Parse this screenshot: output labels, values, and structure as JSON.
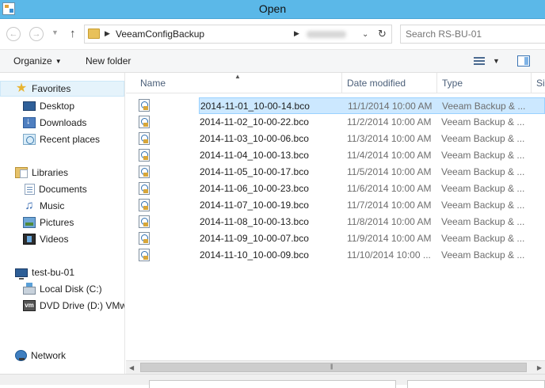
{
  "window": {
    "title": "Open"
  },
  "address": {
    "crumbs": [
      "VeeamConfigBackup"
    ],
    "search_placeholder": "Search RS-BU-01"
  },
  "toolbar": {
    "organize_label": "Organize",
    "new_folder_label": "New folder"
  },
  "nav": {
    "favorites": "Favorites",
    "desktop": "Desktop",
    "downloads": "Downloads",
    "recent": "Recent places",
    "libraries": "Libraries",
    "documents": "Documents",
    "music": "Music",
    "pictures": "Pictures",
    "videos": "Videos",
    "computer": "test-bu-01",
    "local_disk": "Local Disk (C:)",
    "dvd": "DVD Drive (D:) VMw",
    "network": "Network"
  },
  "columns": {
    "name": "Name",
    "date": "Date modified",
    "type": "Type",
    "size": "Siz"
  },
  "files": [
    {
      "name": "2014-11-01_10-00-14.bco",
      "date": "11/1/2014 10:00 AM",
      "type": "Veeam Backup & ..."
    },
    {
      "name": "2014-11-02_10-00-22.bco",
      "date": "11/2/2014 10:00 AM",
      "type": "Veeam Backup & ..."
    },
    {
      "name": "2014-11-03_10-00-06.bco",
      "date": "11/3/2014 10:00 AM",
      "type": "Veeam Backup & ..."
    },
    {
      "name": "2014-11-04_10-00-13.bco",
      "date": "11/4/2014 10:00 AM",
      "type": "Veeam Backup & ..."
    },
    {
      "name": "2014-11-05_10-00-17.bco",
      "date": "11/5/2014 10:00 AM",
      "type": "Veeam Backup & ..."
    },
    {
      "name": "2014-11-06_10-00-23.bco",
      "date": "11/6/2014 10:00 AM",
      "type": "Veeam Backup & ..."
    },
    {
      "name": "2014-11-07_10-00-19.bco",
      "date": "11/7/2014 10:00 AM",
      "type": "Veeam Backup & ..."
    },
    {
      "name": "2014-11-08_10-00-13.bco",
      "date": "11/8/2014 10:00 AM",
      "type": "Veeam Backup & ..."
    },
    {
      "name": "2014-11-09_10-00-07.bco",
      "date": "11/9/2014 10:00 AM",
      "type": "Veeam Backup & ..."
    },
    {
      "name": "2014-11-10_10-00-09.bco",
      "date": "11/10/2014 10:00 ...",
      "type": "Veeam Backup & ..."
    }
  ],
  "colors": {
    "titlebar": "#5bb8e8",
    "selection": "#cce8ff"
  }
}
